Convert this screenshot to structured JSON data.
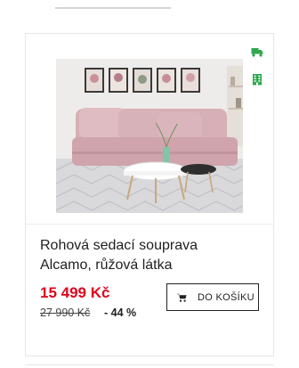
{
  "product": {
    "title_line1": "Rohová sedací souprava",
    "title_line2": "Alcamo, růžová látka",
    "price": "15 499 Kč",
    "old_price": "27 990 Kč",
    "discount": "- 44 %",
    "cart_label": "DO KOŠÍKU",
    "image_icon": "pink-corner-sofa-photo"
  },
  "badges": [
    {
      "icon": "delivery-truck-icon",
      "color": "#2fa84f"
    },
    {
      "icon": "store-building-icon",
      "color": "#2fa84f"
    }
  ],
  "colors": {
    "price": "#e3001b",
    "accent_green": "#2fa84f",
    "border": "#e6e6e6"
  }
}
